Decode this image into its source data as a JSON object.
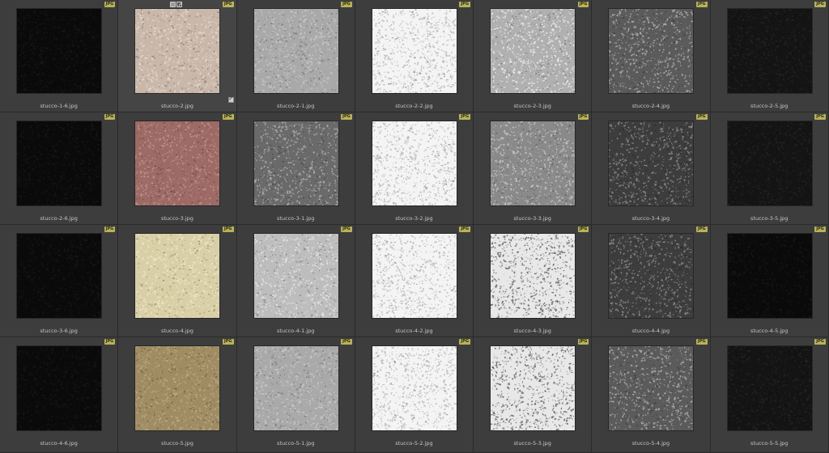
{
  "badge_label": "JPG",
  "selected_check": "✓",
  "files": [
    {
      "name": "stucco-1-6.jpg",
      "texture": "stucco-dark"
    },
    {
      "name": "stucco-2.jpg",
      "texture": "stucco-beige"
    },
    {
      "name": "stucco-2-1.jpg",
      "texture": "stucco-grey"
    },
    {
      "name": "stucco-2-2.jpg",
      "texture": "stucco-white"
    },
    {
      "name": "stucco-2-3.jpg",
      "texture": "stucco-mid"
    },
    {
      "name": "stucco-2-4.jpg",
      "texture": "stucco-darkgrey"
    },
    {
      "name": "stucco-2-5.jpg",
      "texture": "stucco-darker"
    },
    {
      "name": "stucco-2-6.jpg",
      "texture": "stucco-dark"
    },
    {
      "name": "stucco-3.jpg",
      "texture": "stucco-rose"
    },
    {
      "name": "stucco-3-1.jpg",
      "texture": "stucco-slate"
    },
    {
      "name": "stucco-3-2.jpg",
      "texture": "stucco-white"
    },
    {
      "name": "stucco-3-3.jpg",
      "texture": "stucco-grey2"
    },
    {
      "name": "stucco-3-4.jpg",
      "texture": "stucco-charcoal"
    },
    {
      "name": "stucco-3-5.jpg",
      "texture": "stucco-darker"
    },
    {
      "name": "stucco-3-6.jpg",
      "texture": "stucco-dark"
    },
    {
      "name": "stucco-4.jpg",
      "texture": "stucco-cream"
    },
    {
      "name": "stucco-4-1.jpg",
      "texture": "stucco-lightgrey"
    },
    {
      "name": "stucco-4-2.jpg",
      "texture": "stucco-white"
    },
    {
      "name": "stucco-4-3.jpg",
      "texture": "stucco-whitecontrast"
    },
    {
      "name": "stucco-4-4.jpg",
      "texture": "stucco-charcoal"
    },
    {
      "name": "stucco-4-5.jpg",
      "texture": "stucco-dark"
    },
    {
      "name": "stucco-4-6.jpg",
      "texture": "stucco-dark"
    },
    {
      "name": "stucco-5.jpg",
      "texture": "stucco-tan"
    },
    {
      "name": "stucco-5-1.jpg",
      "texture": "stucco-grey"
    },
    {
      "name": "stucco-5-2.jpg",
      "texture": "stucco-white"
    },
    {
      "name": "stucco-5-3.jpg",
      "texture": "stucco-whitecontrast"
    },
    {
      "name": "stucco-5-4.jpg",
      "texture": "stucco-darkgrey"
    },
    {
      "name": "stucco-5-5.jpg",
      "texture": "stucco-darker"
    }
  ],
  "textures": {
    "stucco-dark": {
      "base": "#0a0a0a",
      "speck": "#222222",
      "speck_opacity": 0.5
    },
    "stucco-darker": {
      "base": "#141414",
      "speck": "#2c2c2c",
      "speck_opacity": 0.6
    },
    "stucco-beige": {
      "base": "#c9b8aa",
      "speck": "#efe1d6",
      "speck_opacity": 0.7
    },
    "stucco-grey": {
      "base": "#a9a9a9",
      "speck": "#d2d2d2",
      "speck_opacity": 0.7
    },
    "stucco-grey2": {
      "base": "#8a8a8a",
      "speck": "#cfcfcf",
      "speck_opacity": 0.8
    },
    "stucco-lightgrey": {
      "base": "#bdbdbd",
      "speck": "#eeeeee",
      "speck_opacity": 0.75
    },
    "stucco-white": {
      "base": "#f4f4f4",
      "speck": "#8e8e8e",
      "speck_opacity": 0.45
    },
    "stucco-whitecontrast": {
      "base": "#e8e8e8",
      "speck": "#454545",
      "speck_opacity": 0.7
    },
    "stucco-mid": {
      "base": "#b0b0b0",
      "speck": "#f0f0f0",
      "speck_opacity": 0.85
    },
    "stucco-darkgrey": {
      "base": "#5b5b5b",
      "speck": "#bdbdbd",
      "speck_opacity": 0.75
    },
    "stucco-charcoal": {
      "base": "#3d3d3d",
      "speck": "#a0a0a0",
      "speck_opacity": 0.7
    },
    "stucco-slate": {
      "base": "#6a6a6a",
      "speck": "#bdbdbd",
      "speck_opacity": 0.75
    },
    "stucco-rose": {
      "base": "#9d6a66",
      "speck": "#c99b96",
      "speck_opacity": 0.75
    },
    "stucco-cream": {
      "base": "#d9cfa7",
      "speck": "#f3eccf",
      "speck_opacity": 0.75
    },
    "stucco-tan": {
      "base": "#a08c63",
      "speck": "#c6b38d",
      "speck_opacity": 0.7
    }
  },
  "selected_index": 1
}
